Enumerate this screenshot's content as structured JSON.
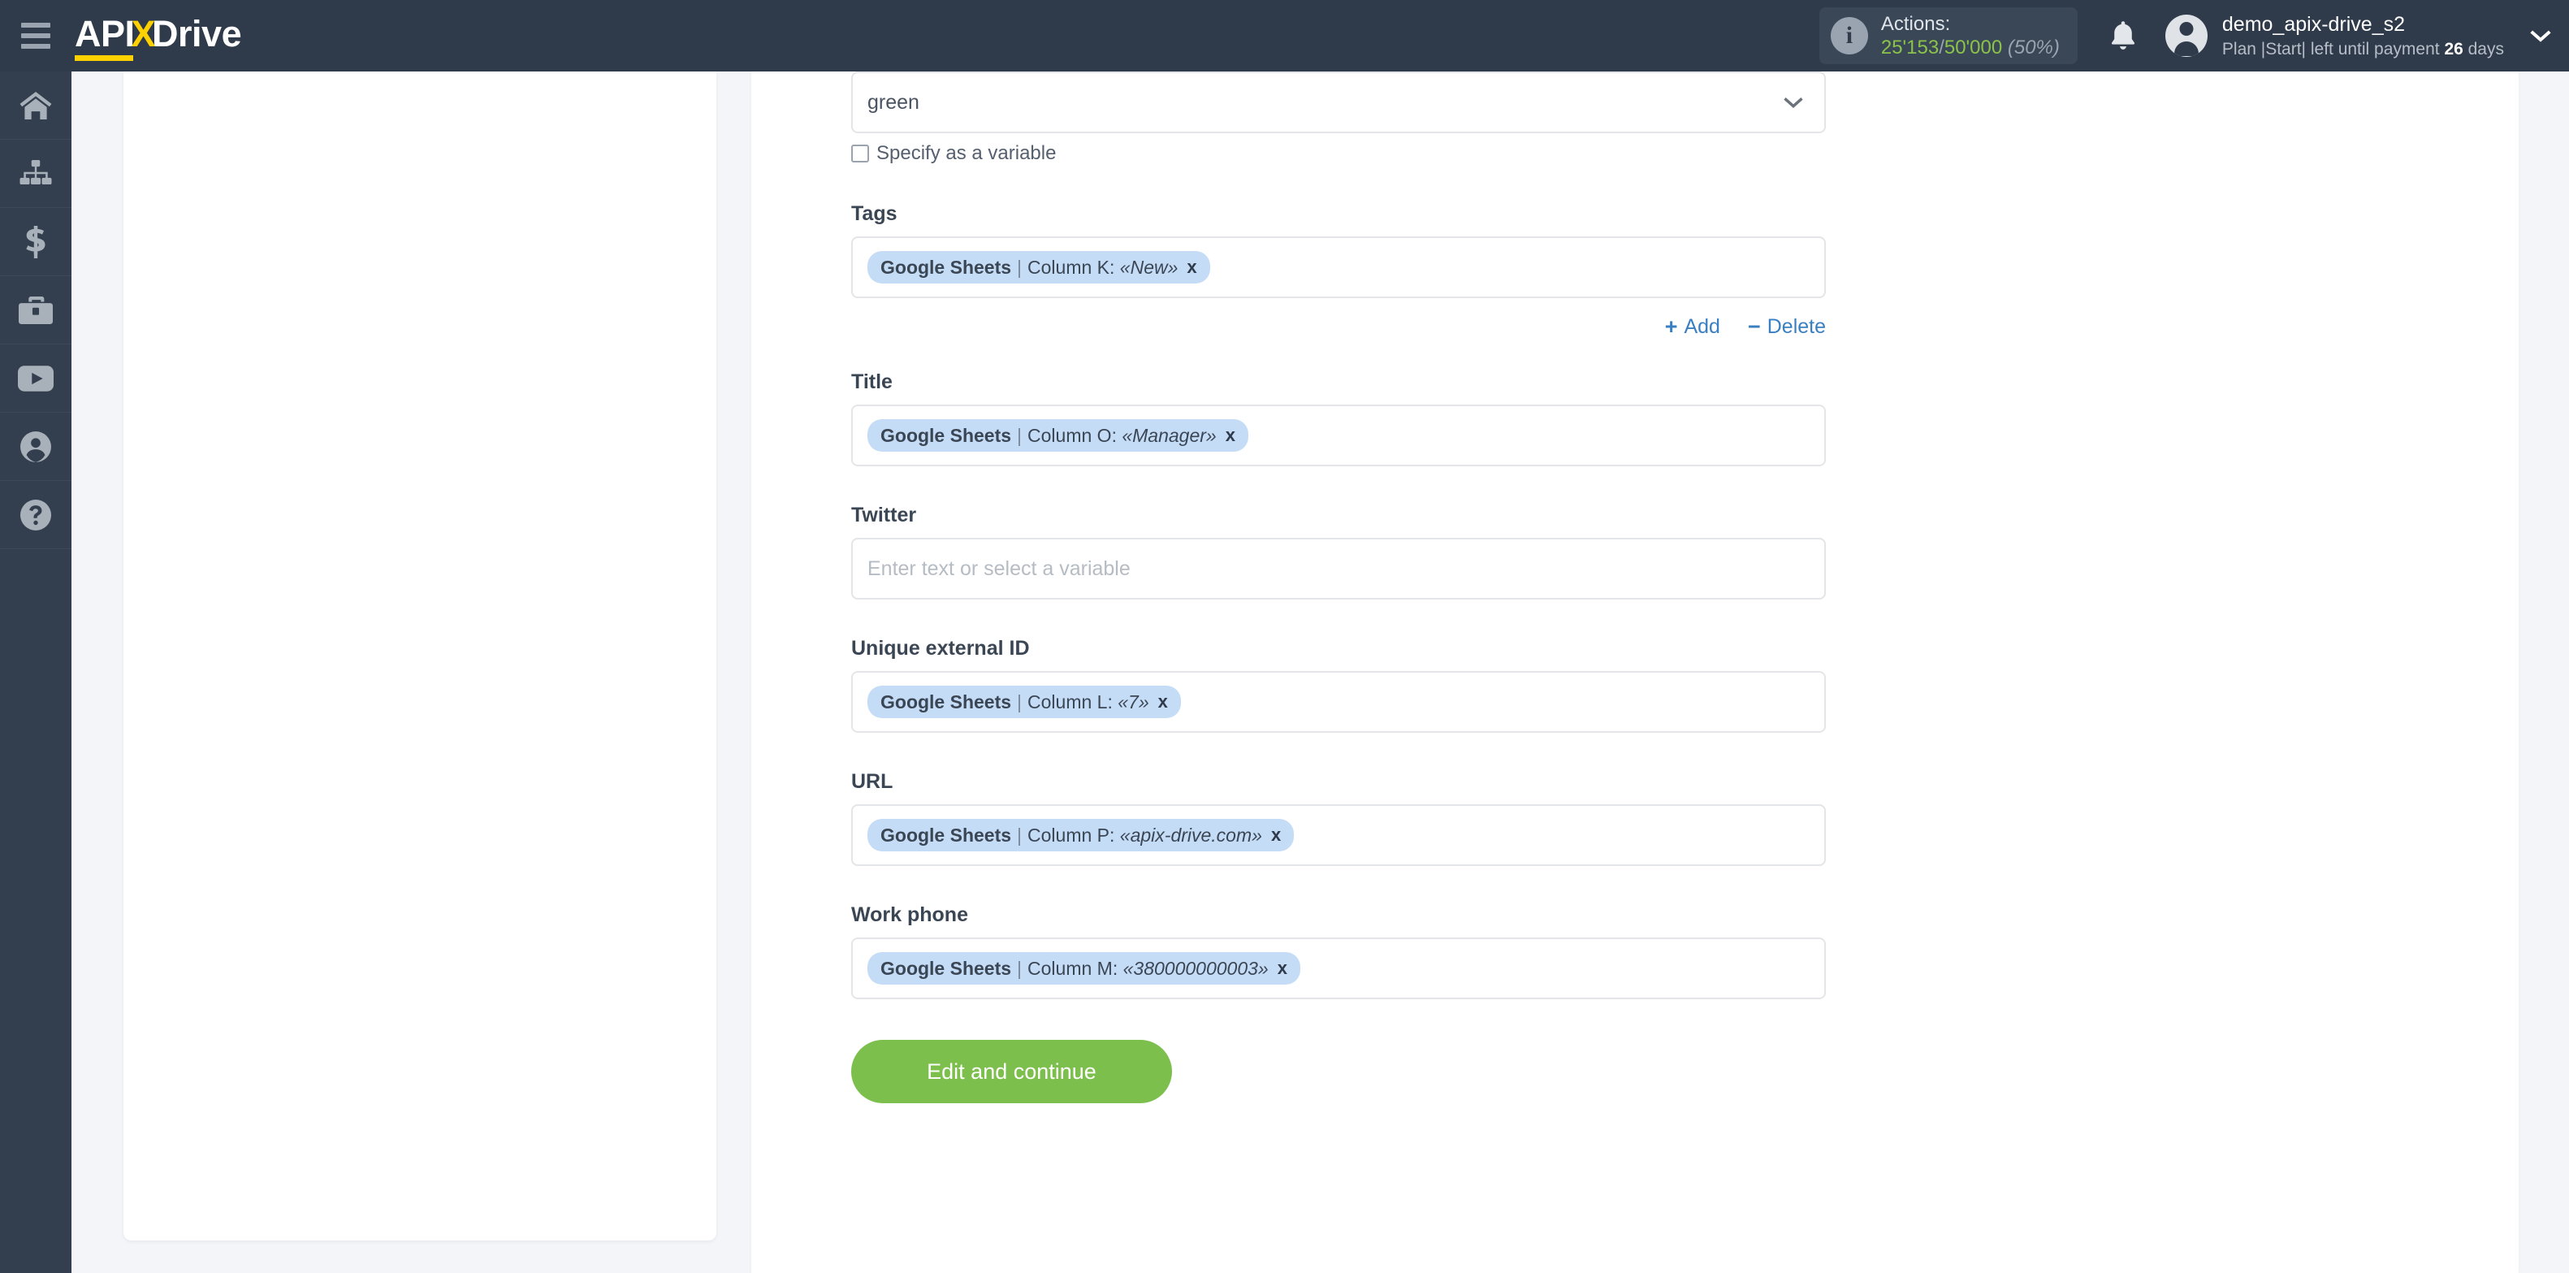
{
  "brand": {
    "logo_api": "API",
    "logo_x": "X",
    "logo_drive": "Drive"
  },
  "header": {
    "actions_label": "Actions:",
    "actions_used": "25'153",
    "actions_separator": "/",
    "actions_total": "50'000",
    "actions_percent": "(50%)",
    "user_name": "demo_apix-drive_s2",
    "plan_prefix": "Plan |Start| left until payment ",
    "plan_days": "26",
    "plan_suffix": " days",
    "accent_green": "#8bc34a",
    "bar_color": "#2f3b4a"
  },
  "sidebar": {
    "items": [
      {
        "icon": "home-icon",
        "label": "Home"
      },
      {
        "icon": "connections-icon",
        "label": "Connections"
      },
      {
        "icon": "dollar-icon",
        "label": "Billing"
      },
      {
        "icon": "briefcase-icon",
        "label": "Business"
      },
      {
        "icon": "youtube-icon",
        "label": "Video"
      },
      {
        "icon": "user-icon",
        "label": "Account"
      },
      {
        "icon": "help-icon",
        "label": "Help"
      }
    ]
  },
  "form": {
    "status_select": {
      "value": "green",
      "chevron": "chevron-down-icon"
    },
    "specify_variable": {
      "label": "Specify as a variable",
      "checked": false
    },
    "fields": [
      {
        "name": "tags",
        "label": "Tags",
        "chip": {
          "source": "Google Sheets",
          "separator": "|",
          "column": "Column K:",
          "value": "«New»",
          "remove": "x"
        },
        "has_addrow": true
      },
      {
        "name": "title",
        "label": "Title",
        "chip": {
          "source": "Google Sheets",
          "separator": "|",
          "column": "Column O:",
          "value": "«Manager»",
          "remove": "x"
        },
        "has_addrow": false
      },
      {
        "name": "twitter",
        "label": "Twitter",
        "placeholder": "Enter text or select a variable",
        "has_addrow": false
      },
      {
        "name": "unique-external-id",
        "label": "Unique external ID",
        "chip": {
          "source": "Google Sheets",
          "separator": "|",
          "column": "Column L:",
          "value": "«7»",
          "remove": "x"
        },
        "has_addrow": false
      },
      {
        "name": "url",
        "label": "URL",
        "chip": {
          "source": "Google Sheets",
          "separator": "|",
          "column": "Column P:",
          "value": "«apix-drive.com»",
          "remove": "x"
        },
        "has_addrow": false
      },
      {
        "name": "work-phone",
        "label": "Work phone",
        "chip": {
          "source": "Google Sheets",
          "separator": "|",
          "column": "Column M:",
          "value": "«380000000003»",
          "remove": "x"
        },
        "has_addrow": false
      }
    ],
    "add_label": "Add",
    "add_symbol": "+",
    "delete_label": "Delete",
    "delete_symbol": "−",
    "submit_label": "Edit and continue",
    "submit_color": "#7dbf4c",
    "link_color": "#3a7fc1",
    "chip_bg": "#c5dcf7"
  }
}
